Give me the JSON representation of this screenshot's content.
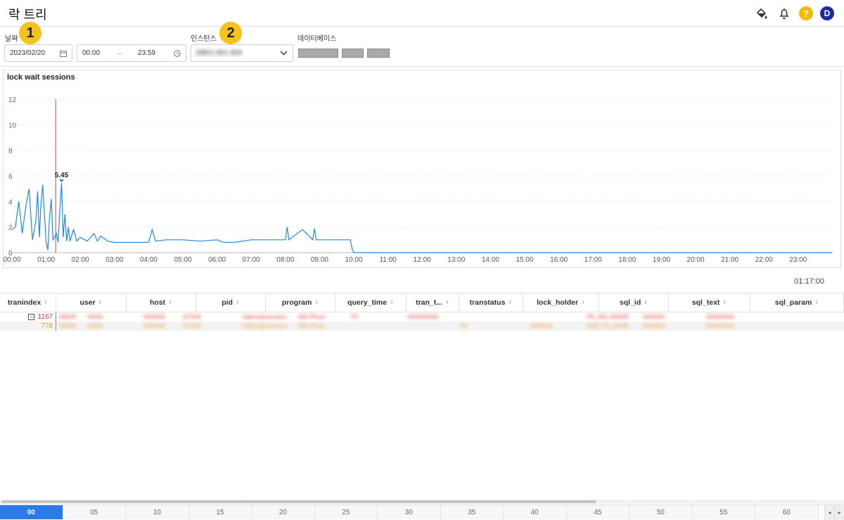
{
  "header": {
    "title": "락 트리",
    "icons": [
      "paint-bucket-icon",
      "bell-icon",
      "help-icon",
      "user-avatar"
    ],
    "help_label": "?",
    "avatar_label": "D"
  },
  "filters": {
    "date_label": "날짜",
    "date_value": "2023/02/20",
    "time_start": "00:00",
    "time_arrow": "→",
    "time_end": "23:59",
    "instance_label": "인스턴스",
    "instance_value": "DB01-001-003",
    "database_label": "데이터베이스",
    "badge1": "1",
    "badge2": "2"
  },
  "chart_data": {
    "type": "line",
    "title": "lock wait sessions",
    "xlabel": "",
    "ylabel": "",
    "ylim": [
      0,
      12
    ],
    "yticks": [
      "0",
      "2",
      "4",
      "6",
      "8",
      "10",
      "12"
    ],
    "xticks": [
      "00:00",
      "01:00",
      "02:00",
      "03:00",
      "04:00",
      "05:00",
      "06:00",
      "07:00",
      "08:00",
      "09:00",
      "10:00",
      "11:00",
      "12:00",
      "13:00",
      "14:00",
      "15:00",
      "16:00",
      "17:00",
      "18:00",
      "19:00",
      "20:00",
      "21:00",
      "22:00",
      "23:00"
    ],
    "series": [
      {
        "color": "#1e88e5",
        "x_hours": [
          0.0,
          0.1,
          0.2,
          0.3,
          0.4,
          0.5,
          0.6,
          0.7,
          0.75,
          0.8,
          0.85,
          0.9,
          1.0,
          1.05,
          1.1,
          1.15,
          1.2,
          1.3,
          1.35,
          1.4,
          1.45,
          1.5,
          1.55,
          1.6,
          1.65,
          1.7,
          1.8,
          1.9,
          2.0,
          2.2,
          2.4,
          2.5,
          2.6,
          2.8,
          3.0,
          3.5,
          4.0,
          4.1,
          4.2,
          4.5,
          5.0,
          5.5,
          6.0,
          6.2,
          6.5,
          7.0,
          7.2,
          7.5,
          8.0,
          8.05,
          8.1,
          8.5,
          8.8,
          8.85,
          8.9,
          9.0,
          9.9,
          9.95,
          10.0,
          24.0
        ],
        "values": [
          1.8,
          2.0,
          4.0,
          1.5,
          3.5,
          5.0,
          1.0,
          2.5,
          4.8,
          1.2,
          3.8,
          5.3,
          0.8,
          0.2,
          2.8,
          4.2,
          1.0,
          1.5,
          0.8,
          3.2,
          5.45,
          1.2,
          3.0,
          0.9,
          2.0,
          0.9,
          1.8,
          0.9,
          1.2,
          0.9,
          1.5,
          0.9,
          1.3,
          0.9,
          0.8,
          0.8,
          0.8,
          1.8,
          0.9,
          1.0,
          1.0,
          0.9,
          1.0,
          0.8,
          0.8,
          1.0,
          1.0,
          1.0,
          1.0,
          2.0,
          1.0,
          1.8,
          1.0,
          1.9,
          1.0,
          1.0,
          1.0,
          0.3,
          0.0,
          0.0
        ]
      }
    ],
    "annotation": {
      "label": "5.45",
      "x_hour": 1.45,
      "value": 5.45
    },
    "cursor_hour": 1.28
  },
  "timer": "01:17:00",
  "table": {
    "columns": [
      "tranindex",
      "user",
      "host",
      "pid",
      "program",
      "query_time",
      "tran_t...",
      "transtatus",
      "lock_holder",
      "sql_id",
      "sql_text",
      "sql_param"
    ],
    "rows": [
      {
        "tranindex": "1167",
        "color": "red",
        "cells": [
          "DB000",
          "00000",
          "0000000",
          "107559",
          "clqlienteprocessor",
          "000.PPsss",
          "PS",
          "0000000000",
          "",
          "",
          "PR_000_000000",
          "0000000",
          "000000000"
        ]
      },
      {
        "tranindex": "778",
        "color": "orange",
        "cells": [
          "DB000",
          "00000",
          "0000000",
          "107559",
          "clqlienteprocessor",
          "000.PPsss",
          "",
          "",
          "PS",
          "0000000",
          "0000_PS_00000",
          "0000000",
          "000000000"
        ]
      }
    ]
  },
  "timeline": {
    "ticks": [
      "00",
      "05",
      "10",
      "15",
      "20",
      "25",
      "30",
      "35",
      "40",
      "45",
      "50",
      "55",
      "60"
    ],
    "active": "00",
    "nav_prev": "◂",
    "nav_next": "▸"
  }
}
